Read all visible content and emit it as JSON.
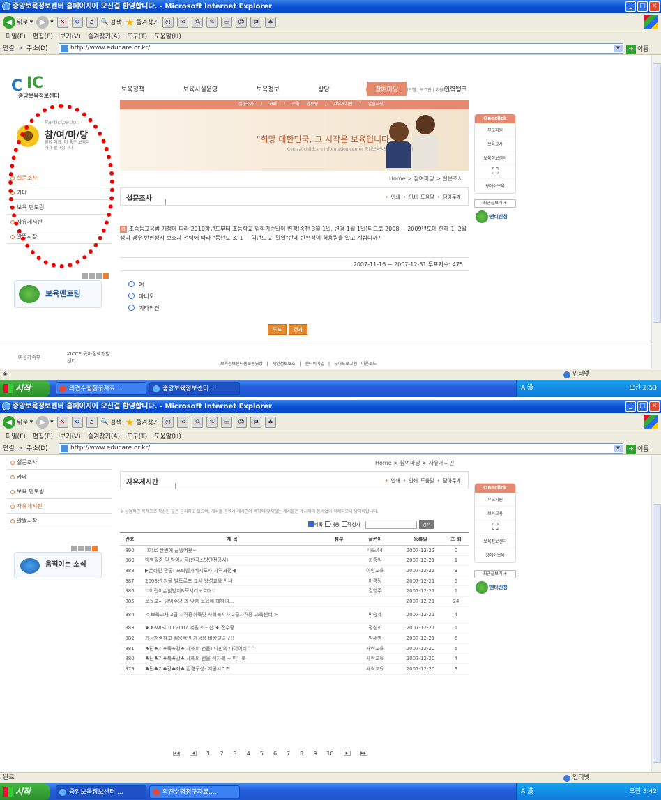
{
  "browser": {
    "title": "중앙보육정보센터 홈페이지에 오신걸 환영합니다. - Microsoft Internet Explorer",
    "back_label": "뒤로",
    "search_label": "검색",
    "favorites_label": "즐겨찾기",
    "menu": [
      "파일(F)",
      "편집(E)",
      "보기(V)",
      "즐겨찾기(A)",
      "도구(T)",
      "도움말(H)"
    ],
    "links_label": "연결",
    "chevron_label": "»",
    "address_label": "주소(D)",
    "url": "http://www.educare.or.kr/",
    "go_label": "이동",
    "zone_label": "인터넷",
    "status_done": "완료"
  },
  "taskbar1": {
    "start_label": "시작",
    "tasks": [
      "의견수렴청구자료...",
      "중앙보육정보센터 ..."
    ],
    "tray_text": "A 漢",
    "clock": "오전 2:53"
  },
  "taskbar2": {
    "start_label": "시작",
    "tasks": [
      "중앙보육정보센터 ...",
      "의견수렴청구자료...."
    ],
    "tray_text": "A 漢",
    "clock": "오전 3:42"
  },
  "site": {
    "logo_text": "중앙보육정보센터",
    "util": "홈으로 | 센터소개 | 사이트맵 | 로그인 | 회원가입",
    "gnb": [
      "보육정책",
      "보육시설운영",
      "보육정보",
      "상담",
      "참여마당",
      "인력뱅크"
    ],
    "subgnb": "설문조사 / 카페 / 보육 멘토링 / 자유게시판 / 알뜰시장",
    "slogan": "\"희망 대한민국, 그 시작은 보육입니다\"",
    "slogan_en": "Central childcare information center 중앙보육정보센터가 함께 하겠습니다.",
    "participation": "Participation",
    "section_title": "참/여/마/당",
    "section_desc": "함께 해요. 더 좋은 보육미래가 펼쳐집니다.",
    "lnav": [
      "설문조사",
      "카페",
      "보육 멘토링",
      "자유게시판",
      "알뜰시장"
    ],
    "banner_mentoring": "보육멘토링",
    "banner_news": "움직이는 소식",
    "tools": [
      "인쇄",
      "인쇄 도움말",
      "담아두기"
    ],
    "quick_head": "Oneclick",
    "quick1": [
      "부모지원",
      "보육교사",
      "보육정보센터",
      "장애아보육"
    ],
    "quick2": [
      "부모지원",
      "보육교사",
      "보육정보센터",
      "장애아보육"
    ],
    "recent_label": "최근글보기 +",
    "mentee_label": "멘티신청",
    "footer_logo1": "여성가족부",
    "footer_logo2": "KICCE 육아정책개발센터",
    "footer_links": "보육정보센터홍보동영상 | 개인정보보호 | 센터이메일 | 뷰어프로그램 다운로드"
  },
  "page1": {
    "location": "Home > 참여마당 > 설문조사",
    "title": "설문조사",
    "question_no": "Q",
    "question": "초중등교육법 개정에 따라 2010학년도부터 초등학교 입학기준일이 변경(종전 3월 1일, 변경 1월 1일)되므로 2008 ~ 2009년도에 한해 1, 2월생의 경우 반편성시 보호자 선택에 따라 \"동년도 3. 1 ~ 익년도 2. 말일\"반에 반편성이 허용됨을 알고 계십니까?",
    "meta": "2007-11-16 ~ 2007-12-31   투표자수: 475",
    "options": [
      "예",
      "아니오",
      "기타의견"
    ],
    "vote_btn": "투표",
    "result_btn": "결과"
  },
  "page2": {
    "location": "Home > 참여마당 > 자유게시판",
    "title": "자유게시판",
    "notice": "※ 상업적인 목적으로 작성된 글은 금지하고 있으며, 게시물 등록시 게시판의 목적에 맞지않는 게시물은 게시자의 동의없이 삭제되오니 양해바랍니다.",
    "search_opts": [
      "제목",
      "내용",
      "작성자"
    ],
    "search_btn": "검색",
    "columns": [
      "번호",
      "제 목",
      "첨부",
      "글쓴이",
      "등록일",
      "조 회"
    ],
    "rows": [
      [
        "890",
        "!!키로 한번에 끝냈어욧~",
        "",
        "나도44",
        "2007-12-22",
        "0"
      ],
      [
        "889",
        "방염필증 및 방염시공(한국소방안전공사)",
        "",
        "최종익",
        "2007-12-21",
        "1"
      ],
      [
        "888",
        "▶온라인 광급! 프뢰벨가베지도사 자격과정◀",
        "",
        "아인교육",
        "2007-12-21",
        "3"
      ],
      [
        "887",
        "2008년 겨울 발도르프 교사 양성교육 안내",
        "",
        "이경탕",
        "2007-12-21",
        "5"
      ],
      [
        "886",
        "♡어린이손힘방지&모서리보호대♡",
        "",
        "김영주",
        "2007-12-21",
        "1"
      ],
      [
        "885",
        "보육교사 담임수당 과 맞춤 보육에 대하여...",
        "",
        "",
        "2007-12-21",
        "24"
      ],
      [
        "884",
        "< 보육교사 2급 자격증취득및 사회복지사 2급자격증 교육센터 >",
        "",
        "박승제",
        "2007-12-21",
        "4"
      ],
      [
        "883",
        "★ K-WISC-III 2007 겨울 워크샵 ★ 접수중",
        "",
        "정성희",
        "2007-12-21",
        "1"
      ],
      [
        "882",
        "가장저렴하고 실용적인 가정용 비상탈출구!!",
        "",
        "박세영",
        "2007-12-21",
        "6"
      ],
      [
        "881",
        "♣단♣기♣특♣강♣ 새해의 선물! 나만의 다이어리^^",
        "",
        "새싹교육",
        "2007-12-20",
        "5"
      ],
      [
        "880",
        "♣단♣기♣특♣강♣ 새해의 선물 색자북 + 미니북",
        "",
        "새싹교육",
        "2007-12-20",
        "4"
      ],
      [
        "879",
        "♣단♣기♣강♣좌♣ 환경구성- 겨울시리즈",
        "",
        "새싹교육",
        "2007-12-20",
        "3"
      ]
    ],
    "pages": [
      "1",
      "2",
      "3",
      "4",
      "5",
      "6",
      "7",
      "8",
      "9",
      "10"
    ]
  }
}
